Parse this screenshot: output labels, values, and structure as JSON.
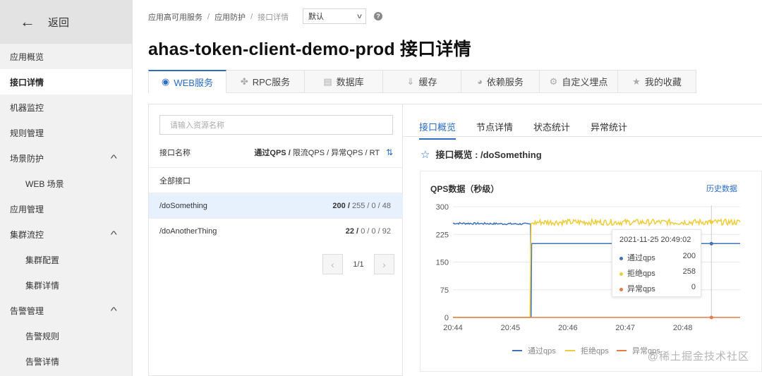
{
  "sidebar": {
    "back_label": "返回",
    "items": [
      {
        "label": "应用概览"
      },
      {
        "label": "接口详情"
      },
      {
        "label": "机器监控"
      },
      {
        "label": "规则管理"
      },
      {
        "label": "场景防护"
      },
      {
        "label": "WEB 场景"
      },
      {
        "label": "应用管理"
      },
      {
        "label": "集群流控"
      },
      {
        "label": "集群配置"
      },
      {
        "label": "集群详情"
      },
      {
        "label": "告警管理"
      },
      {
        "label": "告警规则"
      },
      {
        "label": "告警详情"
      }
    ]
  },
  "breadcrumb": {
    "level1": "应用高可用服务",
    "level2": "应用防护",
    "level3": "接口详情",
    "separator": "/"
  },
  "env_select": {
    "value": "默认"
  },
  "page_title": "ahas-token-client-demo-prod 接口详情",
  "tabs": [
    {
      "label": "WEB服务",
      "icon": "globe-icon"
    },
    {
      "label": "RPC服务",
      "icon": "share-icon"
    },
    {
      "label": "数据库",
      "icon": "database-icon"
    },
    {
      "label": "缓存",
      "icon": "download-icon"
    },
    {
      "label": "依赖服务",
      "icon": "compass-icon"
    },
    {
      "label": "自定义埋点",
      "icon": "gears-icon"
    },
    {
      "label": "我的收藏",
      "icon": "star-icon"
    }
  ],
  "resource_list": {
    "search_placeholder": "请输入资源名称",
    "header_name": "接口名称",
    "header_pass": "通过QPS /",
    "header_rest": "限流QPS / 异常QPS / RT",
    "all_label": "全部接口",
    "rows": [
      {
        "name": "/doSomething",
        "pass": "200 /",
        "rest": "255 / 0 / 48"
      },
      {
        "name": "/doAnotherThing",
        "pass": "22 /",
        "rest": "0 / 0 / 92"
      }
    ],
    "pager_text": "1/1"
  },
  "detail": {
    "subtabs": [
      "接口概览",
      "节点详情",
      "状态统计",
      "异常统计"
    ],
    "overview_title": "接口概览 : /doSomething",
    "chart_title": "QPS数据（秒级）",
    "history_link": "历史数据"
  },
  "tooltip": {
    "time": "2021-11-25 20:49:02",
    "rows": [
      {
        "label": "通过qps",
        "value": "200"
      },
      {
        "label": "拒绝qps",
        "value": "258"
      },
      {
        "label": "异常qps",
        "value": "0"
      }
    ]
  },
  "watermark": "@稀土掘金技术社区",
  "chart_data": {
    "type": "line",
    "title": "QPS数据（秒级）",
    "xlabel": "",
    "ylabel": "",
    "ylim": [
      0,
      300
    ],
    "yticks": [
      0,
      75,
      150,
      225,
      300
    ],
    "x_ticks": [
      "20:44",
      "20:45",
      "20:46",
      "20:47",
      "20:48"
    ],
    "x_range_minutes": [
      0,
      5
    ],
    "grid": true,
    "legend": "bottom",
    "series": [
      {
        "name": "通过qps",
        "color": "#3f72b7",
        "points": [
          [
            0,
            255
          ],
          [
            1.35,
            253
          ],
          [
            1.36,
            0
          ],
          [
            1.37,
            200
          ],
          [
            5,
            200
          ]
        ]
      },
      {
        "name": "拒绝qps",
        "color": "#f0cc3c",
        "points": [
          [
            0,
            0
          ],
          [
            1.34,
            0
          ],
          [
            1.36,
            255
          ],
          [
            1.5,
            258
          ],
          [
            5,
            258
          ]
        ]
      },
      {
        "name": "异常qps",
        "color": "#e57b48",
        "points": [
          [
            0,
            0
          ],
          [
            5,
            0
          ]
        ]
      }
    ],
    "highlight_x": 4.5
  },
  "colors": {
    "accent": "#2b6cc4"
  }
}
